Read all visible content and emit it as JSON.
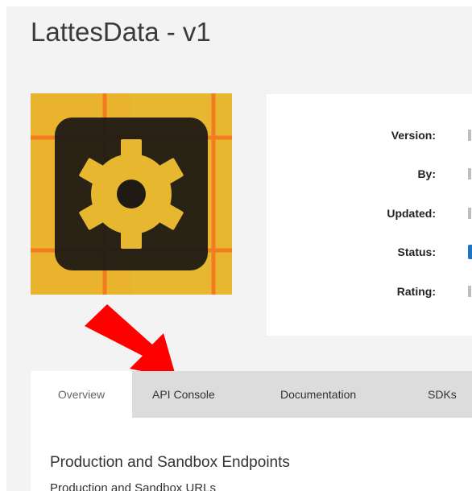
{
  "app": {
    "title": "LattesData - v1",
    "logo_icon": "gear-icon",
    "logo_colors": {
      "tile_background": "#e8b730",
      "grid_lines": "#f37b20",
      "icon_background": "#1f1a14",
      "gear": "#e8b730"
    }
  },
  "info": {
    "version_label": "Version:",
    "by_label": "By:",
    "updated_label": "Updated:",
    "status_label": "Status:",
    "rating_label": "Rating:",
    "status_color": "#1d74c9"
  },
  "annotation": {
    "arrow_icon": "red-arrow-pointer-icon",
    "arrow_color": "#ff0000"
  },
  "tabs": [
    {
      "label": "Overview",
      "active": true
    },
    {
      "label": "API Console",
      "active": false
    },
    {
      "label": "Documentation",
      "active": false
    },
    {
      "label": "SDKs",
      "active": false
    }
  ],
  "overview": {
    "section_title": "Production and Sandbox Endpoints",
    "section_subtitle": "Production and Sandbox URLs"
  }
}
